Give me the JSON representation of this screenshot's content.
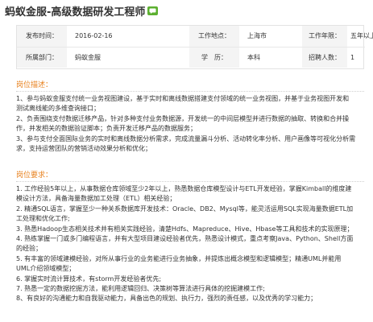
{
  "header": {
    "job_title": "蚂蚁金服-高级数据研发工程师",
    "icon": "chat-icon",
    "icon_color": "#5cb030"
  },
  "info": {
    "row1": [
      {
        "label": "发布时间：",
        "value": "2016-02-16"
      },
      {
        "label": "工作地点：",
        "value": "上海市"
      },
      {
        "label": "工作年限：",
        "value": "五年以上"
      }
    ],
    "row2": [
      {
        "label": "所属部门：",
        "value": "蚂蚁金服"
      },
      {
        "label": "学　历：",
        "value": "本科"
      },
      {
        "label": "招聘人数：",
        "value": "1"
      }
    ]
  },
  "duties": {
    "heading": "岗位描述：",
    "lines": [
      "1、参与蚂蚁金服支付统一业务视图建设，基于实时和离线数据搭建支付领域的统一业务视图，并基于业务视图开发和",
      "测试离线能的多维查询接口；",
      "2、负责围绕支付数据迁移产品，针对多种支付业务数据源，开发统一的中间层模型并进行数据的抽取、转换和合并操",
      "作，并发相关的数据验证脚本；负责开发迁移产品的数据服务；",
      "3、参与支付全面国际业务的实时和离线数据分析需求，完成流量漏斗分析、活动转化率分析、用户画像等可视化分析需",
      "求，支持运营团队的营销活动效果分析和优化；"
    ]
  },
  "requirements": {
    "heading": "岗位要求：",
    "lines": [
      "1. 工作经验5年以上，从事数据仓库领域至少2年以上，熟悉数据仓库模型设计与ETL开发经验，掌握Kimball的维度建",
      "模设计方法，具备海量数据加工处理（ETL）相关经验；",
      "2. 精通SQL语言，掌握至少一种关系数据库开发技术：Oracle、DB2、Mysql等，能灵活运用SQL实现海量数据ETL加",
      "工处理和优化工作;",
      "3. 熟悉Hadoop生态相关技术并有相关实践经验，清楚Hdfs、Mapreduce、Hive、Hbase等工具和技术的实现原理；",
      "4. 熟练掌握一门或多门编程语言，并有大型项目建设经验者优先，熟悉设计模式，重点考察Java、Python、Shell方面",
      "的经验；",
      "5. 有丰富的领域建模经验，对所从事行业的业务能进行业务抽象，并提炼出概念模型和逻辑模型；精通UML并能用",
      "UML介绍领域模型；",
      "6. 掌握实时流计算技术，有storm开发经验者优先;",
      "7. 熟悉一定的数据挖掘方法，能利用逻辑回归、决策树等算法进行具体的挖掘建模工作;",
      "8、有良好的沟通能力和自我驱动能力，具备出色的规划、执行力，强烈的责任感，以及优秀的学习能力；"
    ]
  },
  "colors": {
    "accent": "#e8821f",
    "label_bg": "#f4f4f4",
    "border": "#e3e3e3"
  }
}
